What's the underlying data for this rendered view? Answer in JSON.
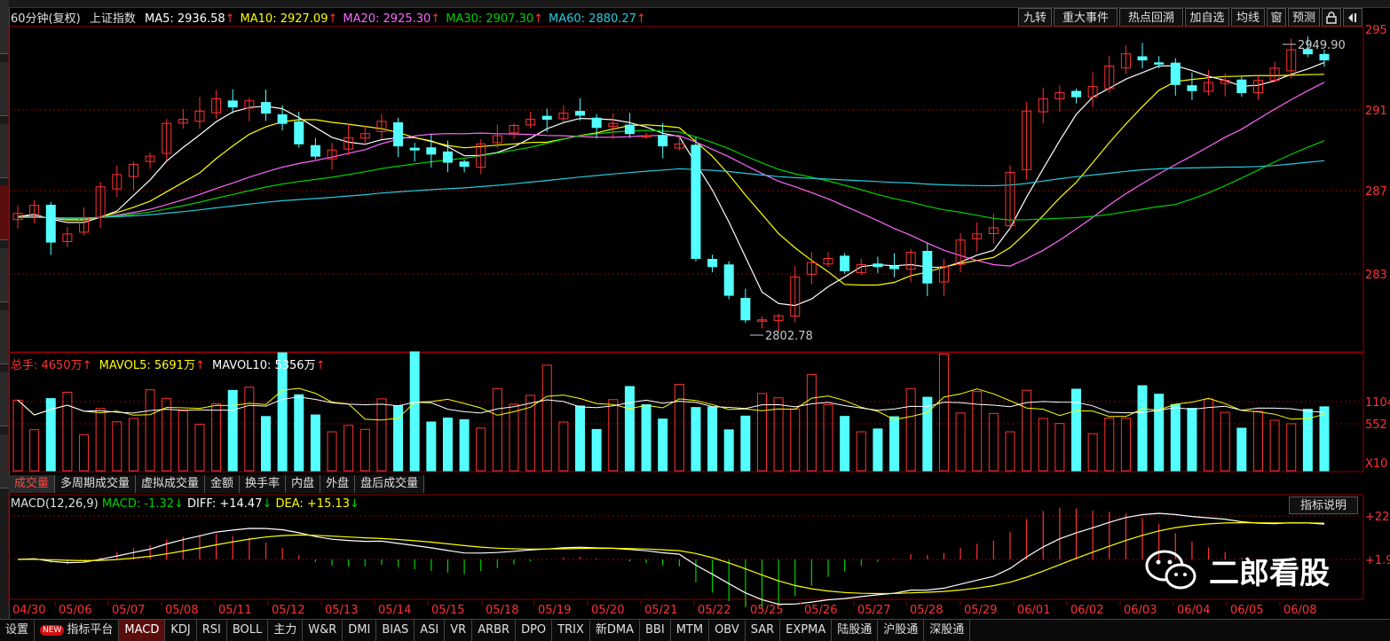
{
  "header": {
    "period": "60分钟(复权)",
    "symbol": "上证指数",
    "ma": [
      {
        "label": "MA5:",
        "value": "2936.58",
        "arrow": "↑",
        "color": "#ffffff"
      },
      {
        "label": "MA10:",
        "value": "2927.09",
        "arrow": "↑",
        "color": "#ffff00"
      },
      {
        "label": "MA20:",
        "value": "2925.30",
        "arrow": "↑",
        "color": "#ff66ff"
      },
      {
        "label": "MA30:",
        "value": "2907.30",
        "arrow": "↑",
        "color": "#00d000"
      },
      {
        "label": "MA60:",
        "value": "2880.27",
        "arrow": "↑",
        "color": "#22ccdd"
      }
    ]
  },
  "toolbar": {
    "buttons": [
      "九转",
      "重大事件",
      "热点回溯",
      "加自选",
      "均线",
      "窗",
      "预测"
    ]
  },
  "price_axis": {
    "labels": [
      "295",
      "291",
      "287",
      "283"
    ]
  },
  "annotations": {
    "high": "2949.90",
    "low": "2802.78"
  },
  "volume": {
    "header": [
      {
        "text": "总手: 4650万",
        "arrow": "↑",
        "color": "#ff3232"
      },
      {
        "text": "MAVOL5: 5691万",
        "arrow": "↑",
        "color": "#ffff00"
      },
      {
        "text": "MAVOL10: 5356万",
        "arrow": "↑",
        "color": "#ffffff"
      }
    ],
    "axis_labels": [
      "1104",
      "552",
      "X10"
    ]
  },
  "subtabs": [
    "成交量",
    "多周期成交量",
    "虚拟成交量",
    "金额",
    "换手率",
    "内盘",
    "外盘",
    "盘后成交量"
  ],
  "macd": {
    "name": "MACD(12,26,9)",
    "macd": "MACD: -1.32",
    "diff": "DIFF: +14.47",
    "dea": "DEA: +15.13",
    "arrow": "↓",
    "explain": "指标说明",
    "axis_labels": [
      "+22",
      "+1.9"
    ]
  },
  "dates": [
    "04/30",
    "05/06",
    "05/07",
    "05/08",
    "05/11",
    "05/12",
    "05/13",
    "05/14",
    "05/15",
    "05/18",
    "05/19",
    "05/20",
    "05/21",
    "05/22",
    "05/25",
    "05/26",
    "05/27",
    "05/28",
    "05/29",
    "06/01",
    "06/02",
    "06/03",
    "06/04",
    "06/05",
    "06/08"
  ],
  "bottom_tabs": [
    "设置",
    "指标平台",
    "MACD",
    "KDJ",
    "RSI",
    "BOLL",
    "主力",
    "W&R",
    "DMI",
    "BIAS",
    "ASI",
    "VR",
    "ARBR",
    "DPO",
    "TRIX",
    "新DMA",
    "BBI",
    "MTM",
    "OBV",
    "SAR",
    "EXPMA",
    "陆股通",
    "沪股通",
    "深股通"
  ],
  "new_tag": "NEW",
  "watermark": "二郎看股",
  "colors": {
    "up": "#ff3232",
    "down": "#54ffff",
    "ma5": "#ffffff",
    "ma10": "#ffff00",
    "ma20": "#ff66ff",
    "ma30": "#00d000",
    "ma60": "#22ccdd",
    "grid": "#8b0000"
  },
  "chart_data": {
    "type": "candlestick",
    "title": "上证指数 60分钟(复权)",
    "high": 2949.9,
    "low": 2802.78,
    "close_series": [
      2860,
      2864,
      2846,
      2850,
      2858,
      2873,
      2879,
      2884,
      2888,
      2904,
      2906,
      2910,
      2916,
      2912,
      2915,
      2909,
      2904,
      2894,
      2888,
      2891,
      2897,
      2899,
      2905,
      2893,
      2891,
      2889,
      2885,
      2883,
      2894,
      2898,
      2903,
      2906,
      2906,
      2909,
      2908,
      2902,
      2904,
      2899,
      2898,
      2893,
      2894,
      2838,
      2834,
      2820,
      2808,
      2808,
      2810,
      2829,
      2836,
      2838,
      2832,
      2835,
      2834,
      2833,
      2841,
      2826,
      2834,
      2847,
      2850,
      2853,
      2880,
      2910,
      2916,
      2919,
      2917,
      2922,
      2932,
      2938,
      2935,
      2933,
      2923,
      2920,
      2924,
      2925,
      2919,
      2925,
      2931,
      2940,
      2938,
      2935
    ],
    "macd_diff_range": [
      -2,
      24
    ],
    "volume_unit": "万"
  }
}
